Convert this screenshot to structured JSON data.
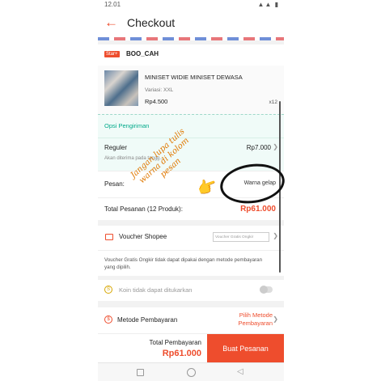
{
  "status": {
    "time": "12.01",
    "signals": "▲▲ ▮"
  },
  "header": {
    "back_glyph": "←",
    "title": "Checkout"
  },
  "shop": {
    "badge": "Star+",
    "name": "BOO_CAH"
  },
  "product": {
    "name": "MINISET WIDIE MINISET DEWASA",
    "variation": "Variasi: XXL",
    "price": "Rp4.500",
    "quantity": "x12"
  },
  "shipping": {
    "label": "Opsi Pengiriman",
    "type": "Reguler",
    "cost": "Rp7.000",
    "eta": "Akan diterima pada tangg..."
  },
  "message": {
    "label": "Pesan:",
    "value": "Warna gelap"
  },
  "order_total": {
    "label": "Total Pesanan (12 Produk):",
    "value": "Rp61.000"
  },
  "voucher": {
    "label": "Voucher Shopee",
    "placeholder": "Voucher Gratis Ongkir",
    "note": "Voucher Gratis Ongkir tidak dapat dipakai dengan metode pembayaran yang dipilih."
  },
  "coins": {
    "label": "Koin tidak dapat ditukarkan",
    "enabled": false
  },
  "payment": {
    "label": "Metode Pembayaran",
    "select_label": "Pilih Metode Pembayaran"
  },
  "footer": {
    "total_label": "Total Pembayaran",
    "total_value": "Rp61.000",
    "buy_label": "Buat Pesanan"
  },
  "annotation": {
    "text": "Jangan lupa tulis warna di kolom pesan",
    "hand_emoji": "👉"
  },
  "colors": {
    "accent": "#ee4d2d",
    "shipping": "#00a98a",
    "annotation": "#e07800"
  },
  "icons": [
    "back-arrow-icon",
    "ticket-icon",
    "coin-icon",
    "payment-icon",
    "chevron-right-icon",
    "home-square-icon",
    "home-circle-icon",
    "back-triangle-icon"
  ]
}
